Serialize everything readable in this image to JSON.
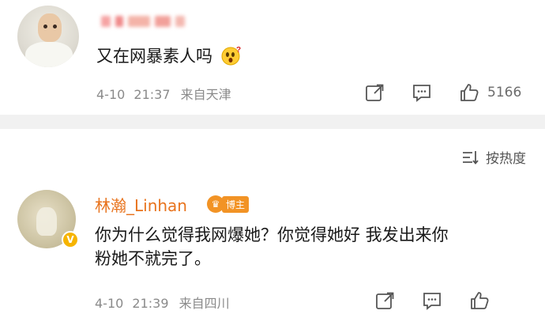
{
  "post": {
    "username_blurred": "",
    "text": "又在网暴素人吗",
    "emoji": "surprised-emoji",
    "date": "4-10",
    "time": "21:37",
    "source": "来自天津",
    "like_count": "5166"
  },
  "sort": {
    "label": "按热度"
  },
  "reply": {
    "username": "林瀚_Linhan",
    "badge": "博主",
    "verified": "V",
    "text_line1": "你为什么觉得我网爆她？你觉得她好 我发出来你",
    "text_line2": "粉她不就完了。",
    "date": "4-10",
    "time": "21:39",
    "source": "来自四川"
  },
  "colors": {
    "accent_orange": "#e8731d",
    "badge_orange": "#f29325",
    "meta_gray": "#8a8a8a",
    "divider_gray": "#f1f1f1"
  },
  "icons": [
    "share-icon",
    "comment-icon",
    "like-icon",
    "sort-icon"
  ]
}
